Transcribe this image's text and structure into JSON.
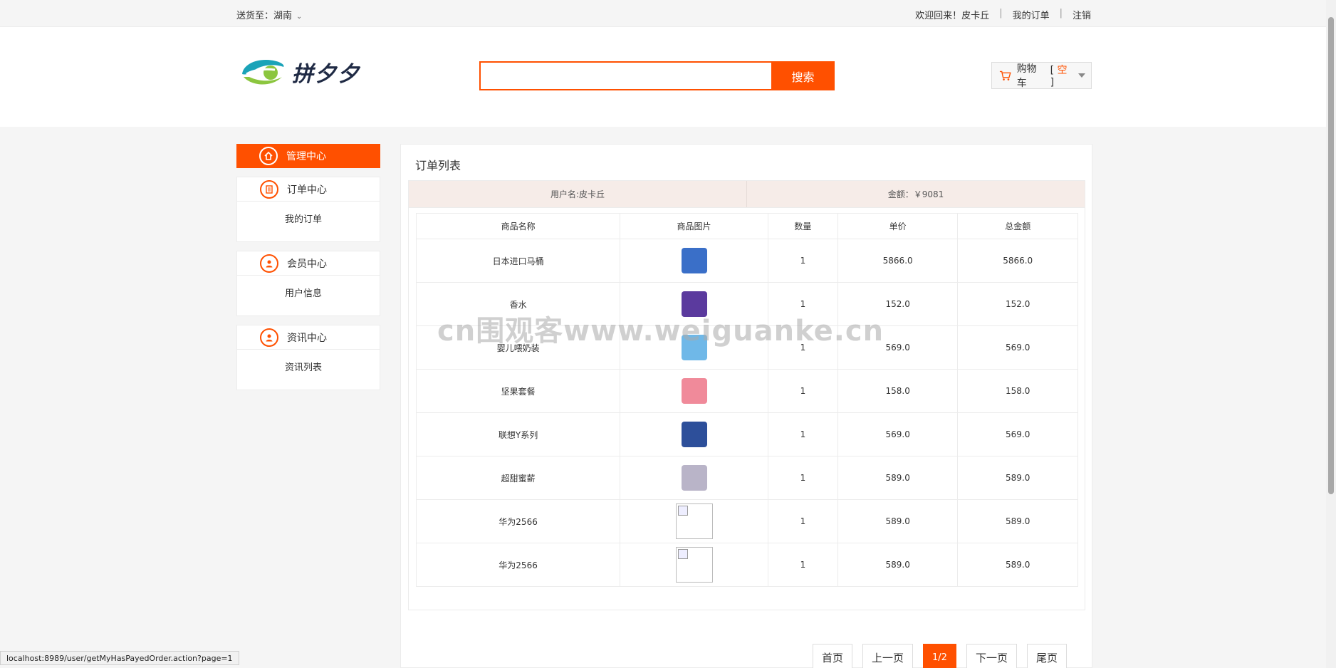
{
  "topbar": {
    "ship_to_label": "送货至：",
    "ship_to_value": "湖南",
    "welcome": "欢迎回来！皮卡丘",
    "my_orders": "我的订单",
    "logout": "注销",
    "separator": "|"
  },
  "header": {
    "brand": "拼夕夕",
    "search_placeholder": "",
    "search_button": "搜索",
    "cart_label": "购物车",
    "cart_bracket_open": "[",
    "cart_empty": "空",
    "cart_bracket_close": "]"
  },
  "colors": {
    "accent": "#ff5000",
    "logo_blue": "#1aa3b8",
    "logo_green": "#8cc63f"
  },
  "sidebar": {
    "active": {
      "label": "管理中心",
      "icon": "home-icon"
    },
    "groups": [
      {
        "label": "订单中心",
        "icon": "order-list-icon",
        "link": "我的订单"
      },
      {
        "label": "会员中心",
        "icon": "user-icon",
        "link": "用户信息"
      },
      {
        "label": "资讯中心",
        "icon": "user-icon",
        "link": "资讯列表"
      }
    ]
  },
  "main": {
    "title": "订单列表",
    "user_label": "用户名:皮卡丘",
    "amount_label": "金额：￥9081",
    "columns": [
      "商品名称",
      "商品图片",
      "数量",
      "单价",
      "总金额"
    ],
    "rows": [
      {
        "name": "日本进口马桶",
        "qty": "1",
        "price": "5866.0",
        "total": "5866.0",
        "img": "product-box",
        "color": "#3a6fc8"
      },
      {
        "name": "香水",
        "qty": "1",
        "price": "152.0",
        "total": "152.0",
        "img": "stroller",
        "color": "#5b3a9e"
      },
      {
        "name": "婴儿喂奶装",
        "qty": "1",
        "price": "569.0",
        "total": "569.0",
        "img": "milk-cans",
        "color": "#6fb8e8"
      },
      {
        "name": "坚果套餐",
        "qty": "1",
        "price": "158.0",
        "total": "158.0",
        "img": "bottle",
        "color": "#f08a9a"
      },
      {
        "name": "联想Y系列",
        "qty": "1",
        "price": "569.0",
        "total": "569.0",
        "img": "snack-pack",
        "color": "#2d4f9a"
      },
      {
        "name": "超甜蜜薪",
        "qty": "1",
        "price": "589.0",
        "total": "589.0",
        "img": "pack",
        "color": "#b9b4c8"
      },
      {
        "name": "华为2566",
        "qty": "1",
        "price": "589.0",
        "total": "589.0",
        "img": "broken",
        "color": ""
      },
      {
        "name": "华为2566",
        "qty": "1",
        "price": "589.0",
        "total": "589.0",
        "img": "broken",
        "color": ""
      }
    ]
  },
  "pager": {
    "first": "首页",
    "prev": "上一页",
    "current": "1/2",
    "next": "下一页",
    "last": "尾页"
  },
  "watermark": "cn围观客www.weiguanke.cn",
  "status_url": "localhost:8989/user/getMyHasPayedOrder.action?page=1"
}
